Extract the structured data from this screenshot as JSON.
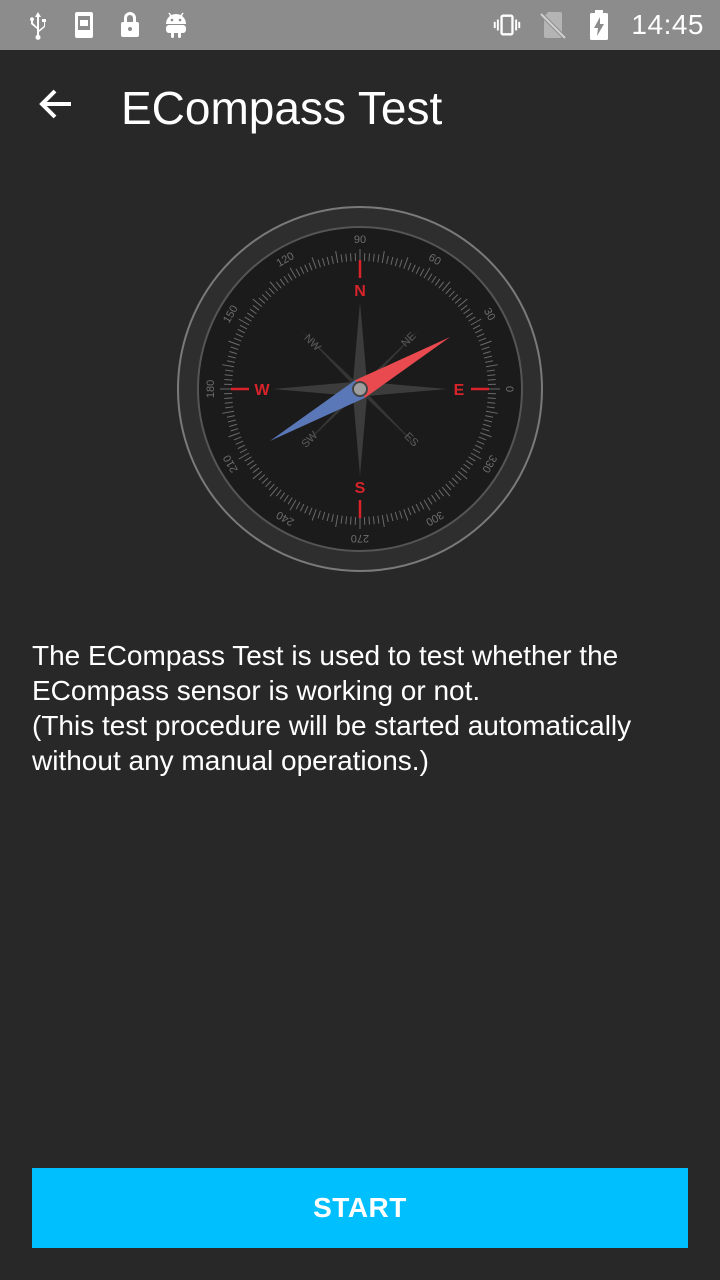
{
  "status_bar": {
    "icons_left": [
      "usb-icon",
      "screenshot-icon",
      "lock-icon",
      "android-icon"
    ],
    "icons_right": [
      "vibrate-icon",
      "no-sim-icon",
      "battery-charging-icon"
    ],
    "time": "14:45"
  },
  "app_bar": {
    "title": "ECompass Test",
    "back_icon": "arrow-back-icon"
  },
  "compass": {
    "cardinals": {
      "north": "N",
      "east": "E",
      "south": "S",
      "west": "W"
    },
    "intercardinals": {
      "ne": "NE",
      "nw": "NW",
      "sw": "SW",
      "se": "ES"
    },
    "degree_labels": [
      "0",
      "30",
      "60",
      "90",
      "120",
      "150",
      "180",
      "210",
      "240",
      "270",
      "300",
      "330"
    ],
    "needle_heading_deg": 60,
    "colors": {
      "needle_north": "#e84a4f",
      "needle_south": "#5a78b8",
      "cardinal": "#d8232a"
    }
  },
  "description": {
    "line1": "The ECompass Test is used to test whether the ECompass sensor is working or not.",
    "line2": "(This test procedure will be started automatically without any manual operations.)"
  },
  "start_button": {
    "label": "START",
    "color": "#00bfff"
  }
}
